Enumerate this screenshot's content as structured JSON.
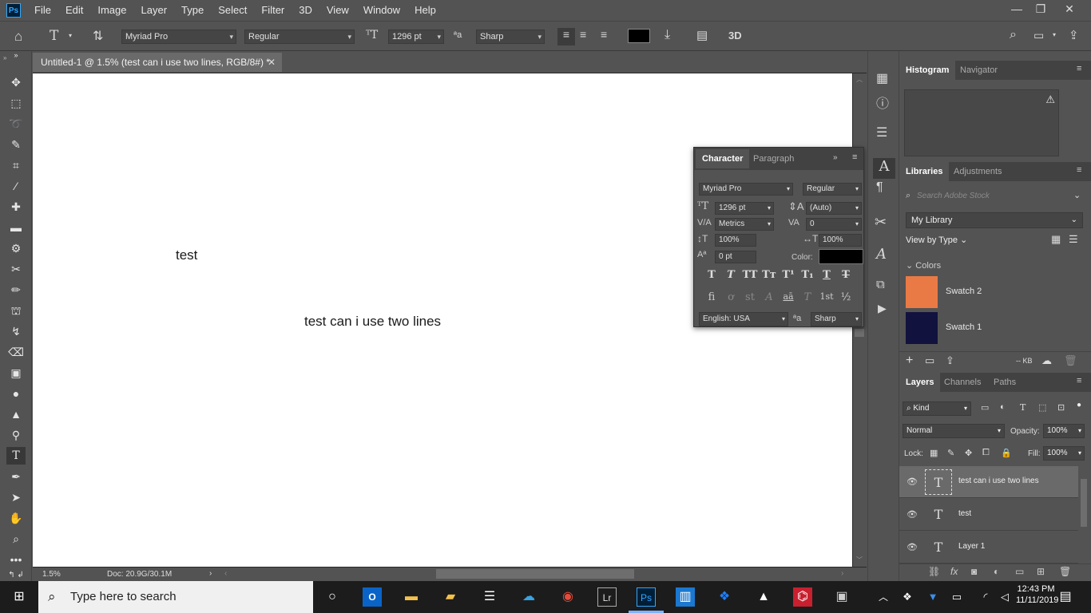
{
  "app": {
    "name": "Ps"
  },
  "menu": [
    "File",
    "Edit",
    "Image",
    "Layer",
    "Type",
    "Select",
    "Filter",
    "3D",
    "View",
    "Window",
    "Help"
  ],
  "options": {
    "font_family": "Myriad Pro",
    "font_style": "Regular",
    "font_size": "1296 pt",
    "antialias": "Sharp",
    "label_3d": "3D",
    "text_color": "#000000"
  },
  "document": {
    "tab_title": "Untitled-1 @ 1.5% (test can i use two lines, RGB/8#) *",
    "text1": "test",
    "text2": "test can i use two lines",
    "zoom": "1.5%",
    "doc_info": "Doc: 20.9G/30.1M"
  },
  "character": {
    "tabs": [
      "Character",
      "Paragraph"
    ],
    "font_family": "Myriad Pro",
    "font_style": "Regular",
    "size": "1296 pt",
    "leading": "(Auto)",
    "kerning": "Metrics",
    "tracking": "0",
    "vscale": "100%",
    "hscale": "100%",
    "baseline": "0 pt",
    "color_label": "Color:",
    "language": "English: USA",
    "antialias": "Sharp",
    "styles_row1": [
      "T",
      "T",
      "TT",
      "Tт",
      "T¹",
      "T₁",
      "T",
      "T"
    ],
    "styles_row2": [
      "fi",
      "ơ",
      "st",
      "A",
      "aā",
      "T",
      "1st",
      "½"
    ]
  },
  "histogram": {
    "tabs": [
      "Histogram",
      "Navigator"
    ]
  },
  "libraries": {
    "tabs": [
      "Libraries",
      "Adjustments"
    ],
    "search_placeholder": "Search Adobe Stock",
    "library": "My Library",
    "view_by": "View by Type",
    "colors_label": "Colors",
    "swatches": [
      {
        "name": "Swatch 2",
        "color": "#ea7a45"
      },
      {
        "name": "Swatch 1",
        "color": "#12123f"
      }
    ],
    "storage": "-- KB"
  },
  "layers": {
    "tabs": [
      "Layers",
      "Channels",
      "Paths"
    ],
    "filter_kind": "Kind",
    "blend_mode": "Normal",
    "opacity_label": "Opacity:",
    "opacity": "100%",
    "lock_label": "Lock:",
    "fill_label": "Fill:",
    "fill": "100%",
    "items": [
      {
        "name": "test can i use two lines"
      },
      {
        "name": "test"
      },
      {
        "name": "Layer 1"
      }
    ]
  },
  "taskbar": {
    "search_placeholder": "Type here to search",
    "time": "12:43 PM",
    "date": "11/11/2019"
  }
}
